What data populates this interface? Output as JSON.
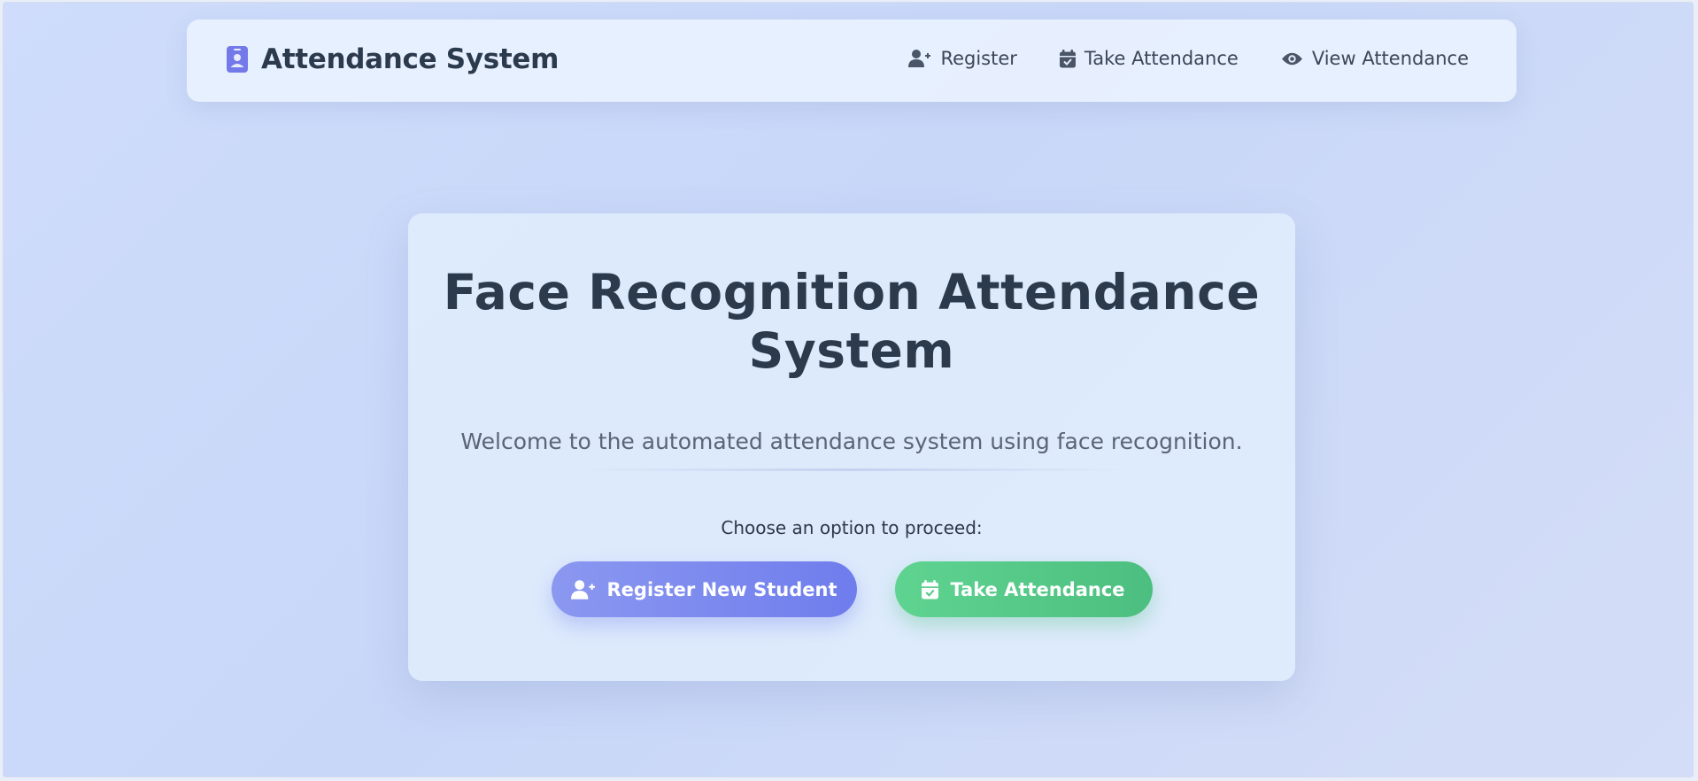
{
  "colors": {
    "brand_icon": "#7479ea",
    "text_dark": "#2c3a4d",
    "primary_button": "#7b88ef",
    "success_button": "#55c987"
  },
  "navbar": {
    "brand": {
      "icon": "id-badge-icon",
      "title": "Attendance System"
    },
    "links": [
      {
        "icon": "user-plus-icon",
        "label": "Register"
      },
      {
        "icon": "calendar-check-icon",
        "label": "Take Attendance"
      },
      {
        "icon": "eye-icon",
        "label": "View Attendance"
      }
    ]
  },
  "hero": {
    "title": "Face Recognition Attendance System",
    "subtitle": "Welcome to the automated attendance system using face recognition.",
    "prompt": "Choose an option to proceed:",
    "buttons": [
      {
        "icon": "user-plus-icon",
        "label": "Register New Student"
      },
      {
        "icon": "calendar-check-icon",
        "label": "Take Attendance"
      }
    ]
  }
}
